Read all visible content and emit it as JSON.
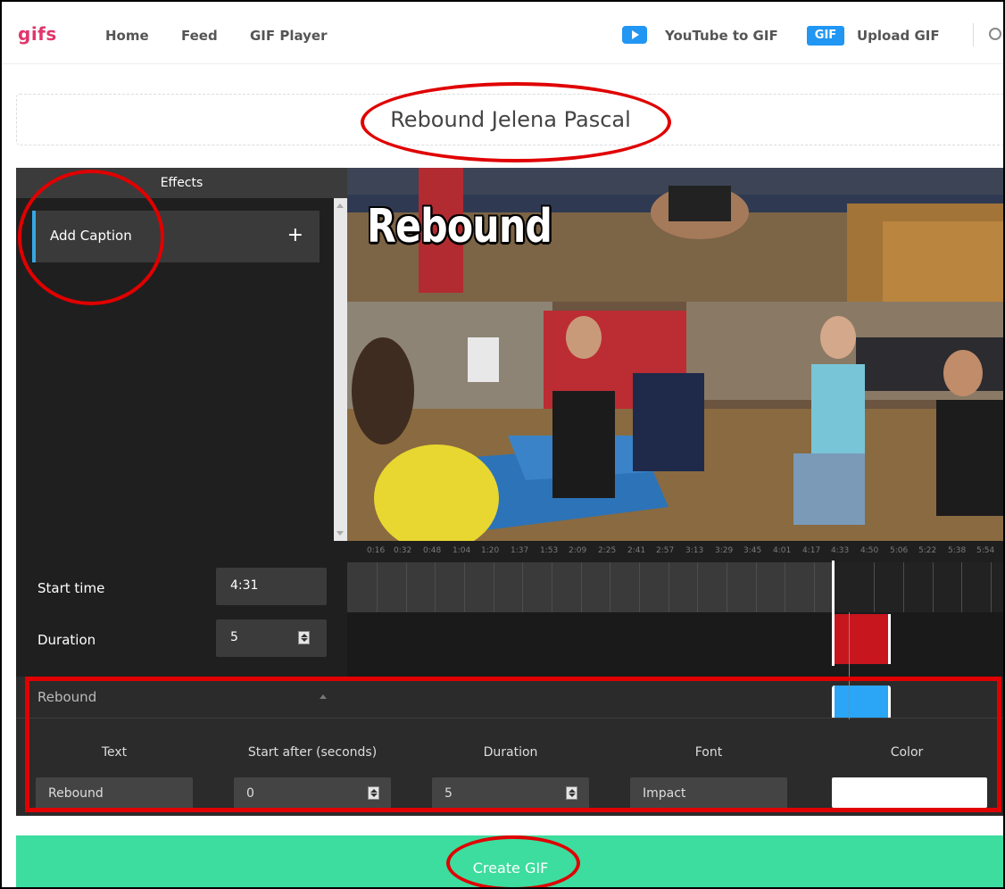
{
  "nav": {
    "logo": "gifs",
    "links": [
      "Home",
      "Feed",
      "GIF Player"
    ],
    "youtube_link": "YouTube to GIF",
    "gif_badge": "GIF",
    "upload_link": "Upload GIF"
  },
  "title": {
    "value": "Rebound Jelena Pascal"
  },
  "effects": {
    "header": "Effects",
    "add_caption": "Add Caption",
    "add_icon": "+"
  },
  "video": {
    "caption_overlay": "Rebound"
  },
  "timeline": {
    "ticks": [
      "0:16",
      "0:32",
      "0:48",
      "1:04",
      "1:20",
      "1:37",
      "1:53",
      "2:09",
      "2:25",
      "2:41",
      "2:57",
      "3:13",
      "3:29",
      "3:45",
      "4:01",
      "4:17",
      "4:33",
      "4:50",
      "5:06",
      "5:22",
      "5:38",
      "5:54"
    ],
    "start_time_label": "Start time",
    "start_time_value": "4:31",
    "duration_label": "Duration",
    "duration_value": "5"
  },
  "caption": {
    "name": "Rebound",
    "fields": {
      "text_label": "Text",
      "text_value": "Rebound",
      "start_label": "Start after (seconds)",
      "start_value": "0",
      "duration_label": "Duration",
      "duration_value": "5",
      "font_label": "Font",
      "font_value": "Impact",
      "color_label": "Color",
      "color_value": "#ffffff"
    }
  },
  "create_button": "Create GIF",
  "colors": {
    "brand": "#e0366b",
    "accent_blue": "#2196f3",
    "create_green": "#3ddc9f",
    "clip_red": "#c8161e",
    "clip_blue": "#2ba5f5",
    "annotation_red": "#e00000"
  }
}
